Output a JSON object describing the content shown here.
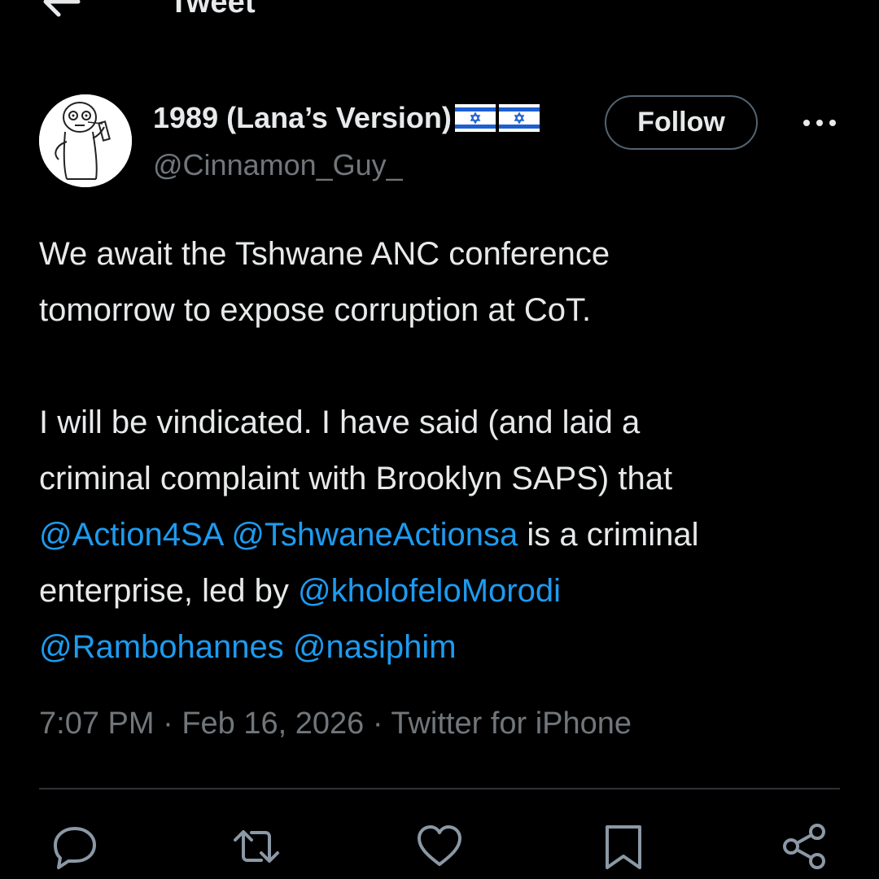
{
  "header": {
    "title": "Tweet",
    "back_icon": "arrow-left-icon"
  },
  "author": {
    "display_name": "1989 (Lana’s Version)",
    "flags": [
      "israel-flag-icon",
      "israel-flag-icon"
    ],
    "handle": "@Cinnamon_Guy_",
    "follow_label": "Follow",
    "more_icon": "more-horizontal-icon"
  },
  "tweet": {
    "line1": "We await the Tshwane ANC conference",
    "line2": "tomorrow to expose corruption at CoT.",
    "line3": "I will be vindicated. I have said (and laid a",
    "line4": "criminal complaint with Brooklyn SAPS) that",
    "mention1": "@Action4SA",
    "mention2": "@TshwaneActionsa",
    "line5_tail": "is a criminal",
    "line6_head": "enterprise, led by",
    "mention3": "@kholofeloMorodi",
    "mention4": "@Rambohannes",
    "mention5": "@nasiphim"
  },
  "meta": {
    "time": "7:07 PM",
    "separator": "·",
    "date": "Feb 16, 2026",
    "source": "Twitter for iPhone"
  },
  "actions": [
    "reply-icon",
    "retweet-icon",
    "like-icon",
    "bookmark-icon",
    "share-icon"
  ],
  "colors": {
    "background": "#000000",
    "text": "#e7e9ea",
    "secondary": "#71767b",
    "link": "#1d9bf0",
    "border": "#2f3336"
  }
}
